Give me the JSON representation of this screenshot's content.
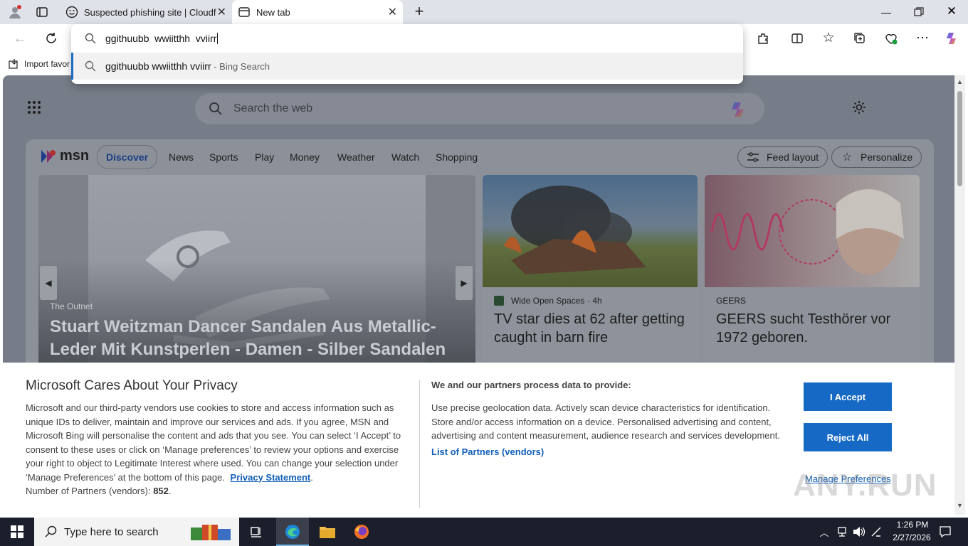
{
  "tabs": [
    {
      "label": "Suspected phishing site | Cloudfla",
      "icon": "smiley-icon"
    },
    {
      "label": "New tab",
      "icon": "newtab-icon"
    }
  ],
  "omnibox": {
    "value": "ggithuubb  wwiitthh  vviirr",
    "suggestion_text": "ggithuubb wwiitthh vviirr",
    "suggestion_source": " - Bing Search"
  },
  "bookmarks": {
    "import_label": "Import favor"
  },
  "newtab": {
    "search_placeholder": "Search the web",
    "msn_logo": "msn",
    "nav": [
      "Discover",
      "News",
      "Sports",
      "Play",
      "Money",
      "Weather",
      "Watch",
      "Shopping"
    ],
    "feed_layout": "Feed layout",
    "personalize": "Personalize",
    "hero": {
      "source": "The Outnet",
      "title": "Stuart Weitzman Dancer Sandalen Aus Metallic-Leder Mit Kunstperlen - Damen - Silber Sandalen -..."
    },
    "card2": {
      "source": "Wide Open Spaces",
      "age": "· 4h",
      "title": "TV star dies at 62 after getting caught in barn fire"
    },
    "card3": {
      "source": "GEERS",
      "title": "GEERS sucht Testhörer vor 1972 geboren."
    }
  },
  "privacy": {
    "heading": "Microsoft Cares About Your Privacy",
    "body": "Microsoft and our third-party vendors use cookies to store and access information such as unique IDs to deliver, maintain and improve our services and ads. If you agree, MSN and Microsoft Bing will personalise the content and ads that you see. You can select ‘I Accept’ to consent to these uses or click on ‘Manage preferences’ to review your options and exercise your right to object to Legitimate Interest where used.  You can change your selection under ‘Manage Preferences’ at the bottom of this page.",
    "privacy_link": "Privacy Statement",
    "partners_label": "Number of Partners (vendors): ",
    "partners_count": "852",
    "right_heading": "We and our partners process data to provide:",
    "right_body": "Use precise geolocation data. Actively scan device characteristics for identification. Store and/or access information on a device. Personalised advertising and content, advertising and content measurement, audience research and services development.",
    "partners_link": "List of Partners (vendors)",
    "accept": "I Accept",
    "reject": "Reject All",
    "manage": "Manage Preferences"
  },
  "watermark": "ANY.RUN",
  "taskbar": {
    "search_placeholder": "Type here to search",
    "time": "1:26 PM",
    "date": "2/27/2026"
  },
  "colors": {
    "accent": "#1669c5",
    "taskbar": "#1b1f2c",
    "overlay": "#777d88"
  }
}
